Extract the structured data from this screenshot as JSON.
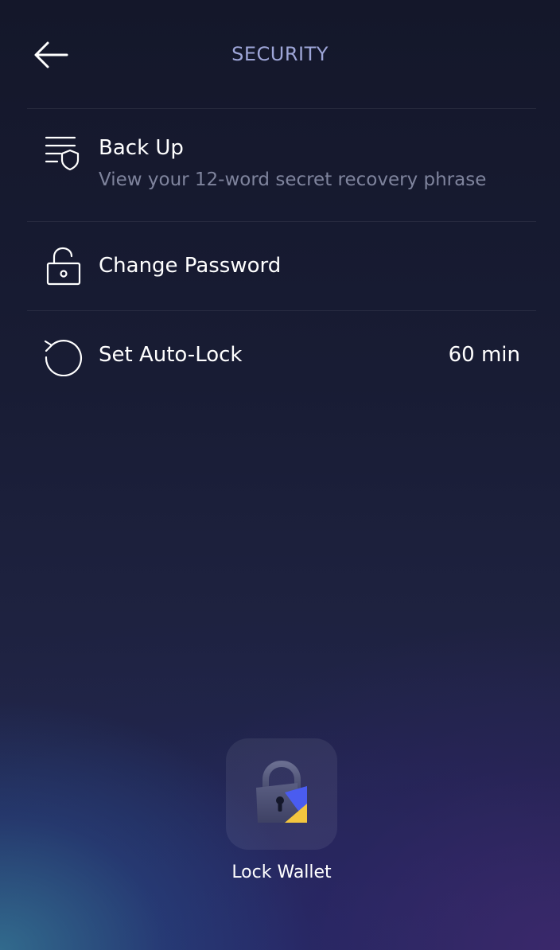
{
  "header": {
    "title": "SECURITY",
    "back_icon": "arrow-left-icon"
  },
  "items": [
    {
      "label": "Back Up",
      "description": "View your 12-word secret recovery phrase",
      "icon": "list-shield-icon"
    },
    {
      "label": "Change Password",
      "icon": "unlocked-padlock-icon"
    },
    {
      "label": "Set Auto-Lock",
      "value": "60 min",
      "icon": "rotate-left-icon"
    }
  ],
  "lock_wallet": {
    "label": "Lock Wallet",
    "icon": "lock-wallet-icon"
  },
  "colors": {
    "title": "#9ea6d8",
    "secondary_text": "#7f849d",
    "accent_blue": "#4a5cf0",
    "accent_yellow": "#f3c63f"
  }
}
